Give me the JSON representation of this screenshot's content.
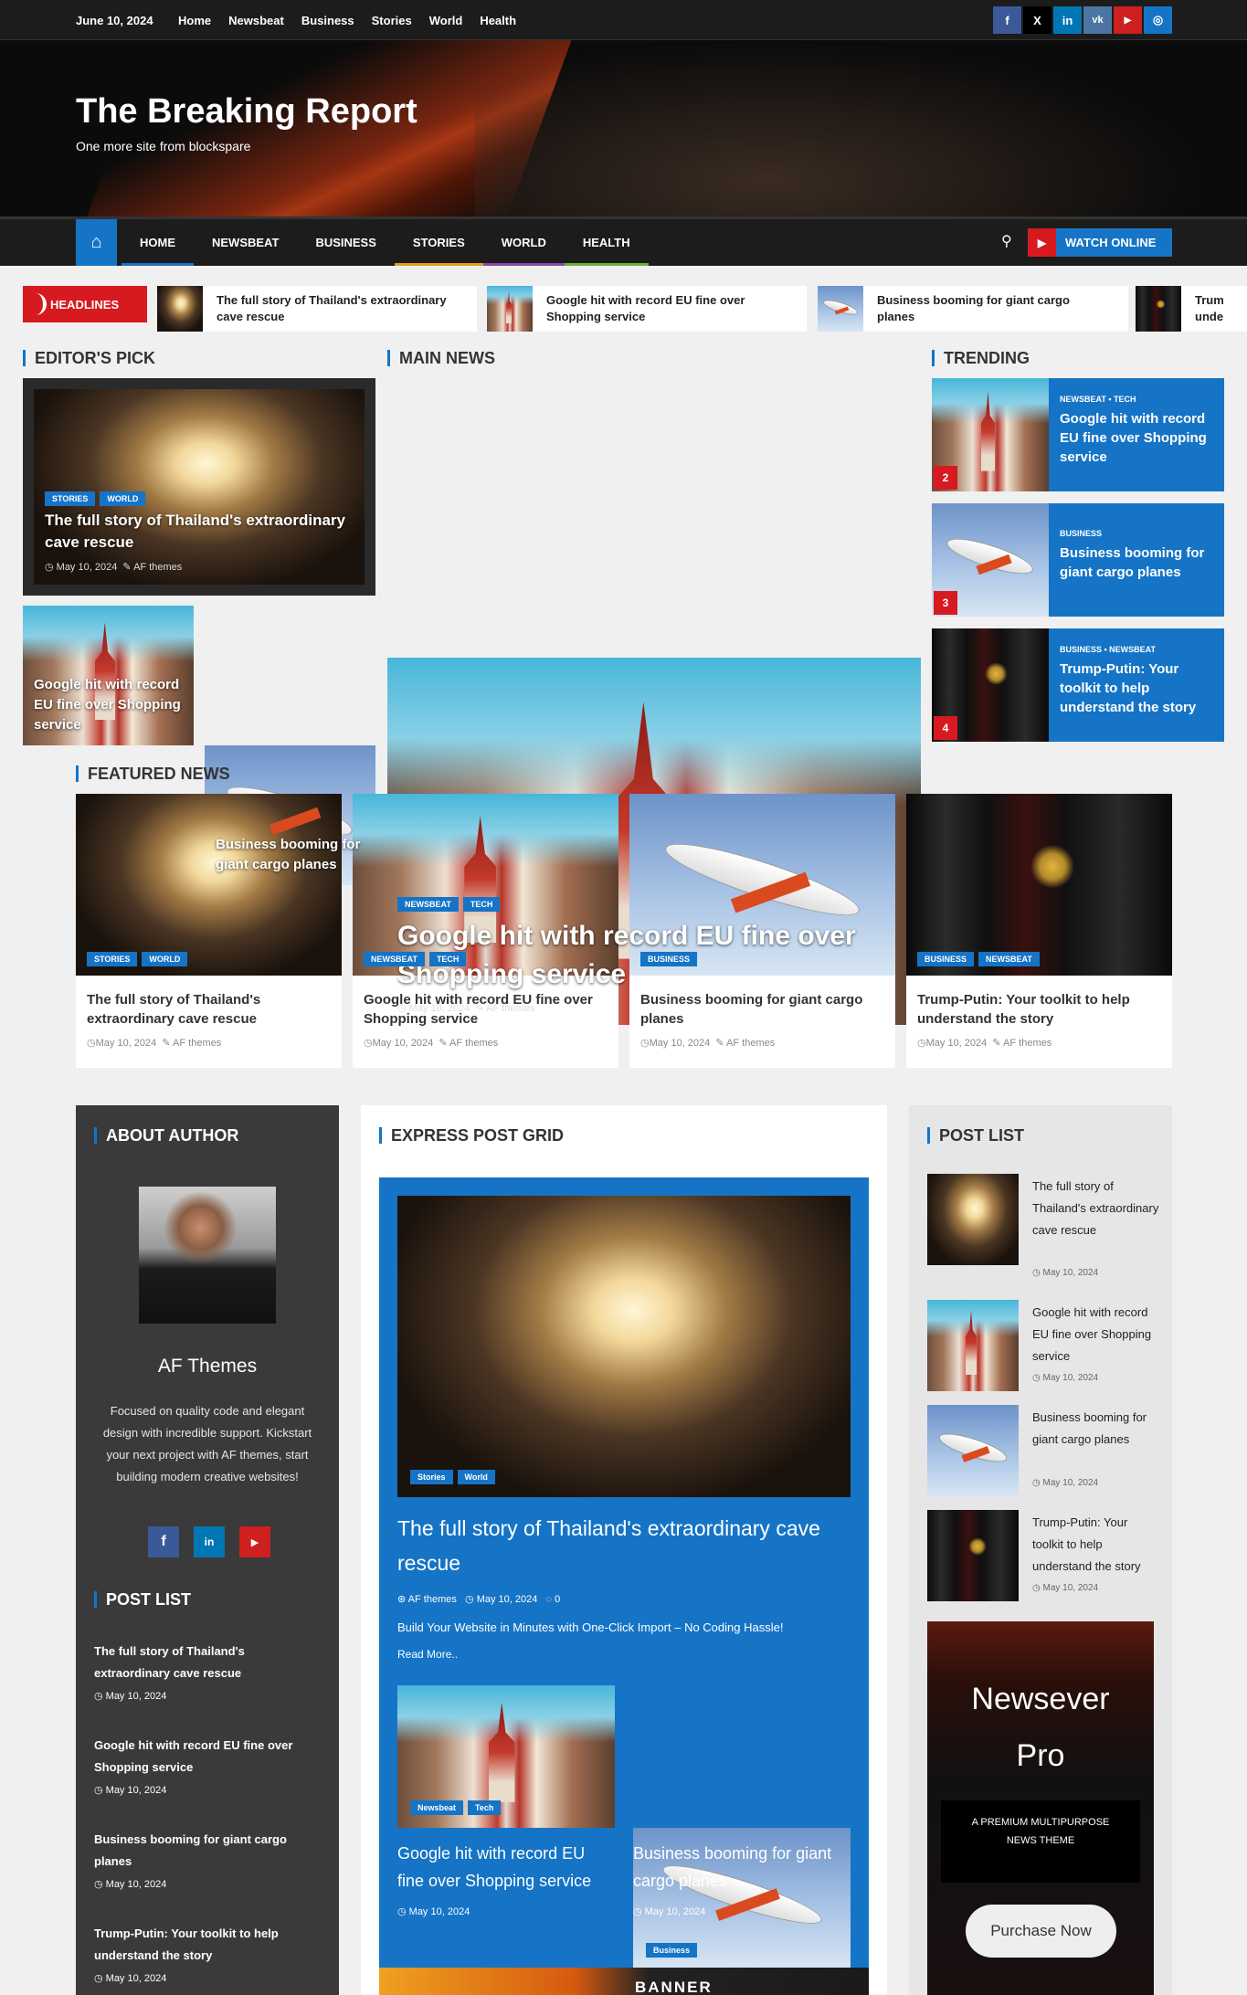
{
  "topbar": {
    "date": "June 10, 2024",
    "links": [
      "Home",
      "Newsbeat",
      "Business",
      "Stories",
      "World",
      "Health"
    ],
    "social": [
      {
        "icon": "facebook-icon",
        "glyph": "f",
        "color": "#3b5998"
      },
      {
        "icon": "x-icon",
        "glyph": "𝕏",
        "color": "#000000"
      },
      {
        "icon": "linkedin-icon",
        "glyph": "in",
        "color": "#0077b5"
      },
      {
        "icon": "vk-icon",
        "glyph": "vk",
        "color": "#4c75a3"
      },
      {
        "icon": "youtube-icon",
        "glyph": "▶",
        "color": "#cd201f"
      },
      {
        "icon": "instagram-icon",
        "glyph": "◎",
        "color": "#1574c6"
      }
    ]
  },
  "header": {
    "title": "The Breaking Report",
    "tagline": "One more site from blockspare"
  },
  "mainnav": {
    "items": [
      {
        "label": "HOME",
        "color": "#1574c6"
      },
      {
        "label": "NEWSBEAT",
        "color": "#1c1c1c"
      },
      {
        "label": "BUSINESS",
        "color": "#1c1c1c"
      },
      {
        "label": "STORIES",
        "color": "#e2a012"
      },
      {
        "label": "WORLD",
        "color": "#8e44ad"
      },
      {
        "label": "HEALTH",
        "color": "#6ab42d"
      }
    ],
    "watch_label": "WATCH ONLINE"
  },
  "ticker": {
    "label": "HEADLINES",
    "items": [
      "The full story of Thailand's extraordinary cave rescue",
      "Google hit with record EU fine over Shopping service",
      "Business booming for giant cargo planes",
      "Trum unde"
    ]
  },
  "editors_pick": {
    "title": "EDITOR'S PICK",
    "main": {
      "cats": [
        "STORIES",
        "WORLD"
      ],
      "title": "The full story of Thailand's extraordinary cave rescue",
      "date": "May 10, 2024",
      "author": "AF themes"
    },
    "small": [
      {
        "title": "Google hit with record EU fine over Shopping service"
      },
      {
        "title": "Business booming for giant cargo planes"
      }
    ]
  },
  "main_news": {
    "title": "MAIN NEWS",
    "cats": [
      "NEWSBEAT",
      "TECH"
    ],
    "headline": "Google hit with record EU fine over Shopping service",
    "date": "May 10, 2024",
    "author": "AF themes"
  },
  "trending": {
    "title": "TRENDING",
    "items": [
      {
        "num": "2",
        "cats": "NEWSBEAT • TECH",
        "title": "Google hit with record EU fine over Shopping service"
      },
      {
        "num": "3",
        "cats": "BUSINESS",
        "title": "Business booming for giant cargo planes"
      },
      {
        "num": "4",
        "cats": "BUSINESS • NEWSBEAT",
        "title": "Trump-Putin: Your toolkit to help understand the story"
      }
    ]
  },
  "featured": {
    "title": "FEATURED NEWS",
    "items": [
      {
        "cats": [
          "STORIES",
          "WORLD"
        ],
        "title": "The full story of Thailand's extraordinary cave rescue",
        "date": "May 10, 2024",
        "author": "AF themes"
      },
      {
        "cats": [
          "NEWSBEAT",
          "TECH"
        ],
        "title": "Google hit with record EU fine over Shopping service",
        "date": "May 10, 2024",
        "author": "AF themes"
      },
      {
        "cats": [
          "BUSINESS"
        ],
        "title": "Business booming for giant cargo planes",
        "date": "May 10, 2024",
        "author": "AF themes"
      },
      {
        "cats": [
          "BUSINESS",
          "NEWSBEAT"
        ],
        "title": "Trump-Putin: Your toolkit to help understand the story",
        "date": "May 10, 2024",
        "author": "AF themes"
      }
    ]
  },
  "about": {
    "title": "ABOUT AUTHOR",
    "name": "AF Themes",
    "bio": "Focused on quality code and elegant design with incredible support. Kickstart your next project with AF themes, start building modern creative websites!"
  },
  "post_list_dark": {
    "title": "POST LIST",
    "items": [
      {
        "title": "The full story of Thailand's extraordinary cave rescue",
        "date": "May 10, 2024"
      },
      {
        "title": "Google hit with record EU fine over Shopping service",
        "date": "May 10, 2024"
      },
      {
        "title": "Business booming for giant cargo planes",
        "date": "May 10, 2024"
      },
      {
        "title": "Trump-Putin: Your toolkit to help understand the story",
        "date": "May 10, 2024"
      }
    ]
  },
  "express": {
    "title": "EXPRESS POST GRID",
    "main": {
      "cats": [
        "Stories",
        "World"
      ],
      "title": "The full story of Thailand's extraordinary cave rescue",
      "author": "AF themes",
      "date": "May 10, 2024",
      "comments": "0",
      "excerpt": "Build Your Website in Minutes with One-Click Import – No Coding Hassle!",
      "read_more": "Read More.."
    },
    "small": [
      {
        "cats": [
          "Newsbeat",
          "Tech"
        ],
        "title": "Google hit with record EU fine over Shopping service",
        "date": "May 10, 2024"
      },
      {
        "cats": [
          "Business"
        ],
        "title": "Business booming for giant cargo planes",
        "date": "May 10, 2024"
      }
    ],
    "banner_text": "BANNER ADVERTISEMENT"
  },
  "post_list_light": {
    "title": "POST LIST",
    "items": [
      {
        "title": "The full story of Thailand's extraordinary cave rescue",
        "date": "May 10, 2024"
      },
      {
        "title": "Google hit with record EU fine over Shopping service",
        "date": "May 10, 2024"
      },
      {
        "title": "Business booming for giant cargo planes",
        "date": "May 10, 2024"
      },
      {
        "title": "Trump-Putin: Your toolkit to help understand the story",
        "date": "May 10, 2024"
      }
    ]
  },
  "promo": {
    "line1": "Newsever",
    "line2": "Pro",
    "sub": "A PREMIUM MULTIPURPOSE NEWS THEME",
    "button": "Purchase Now"
  },
  "colors": {
    "accent": "#1574c6",
    "red": "#d71920",
    "dark": "#1c1c1c"
  }
}
